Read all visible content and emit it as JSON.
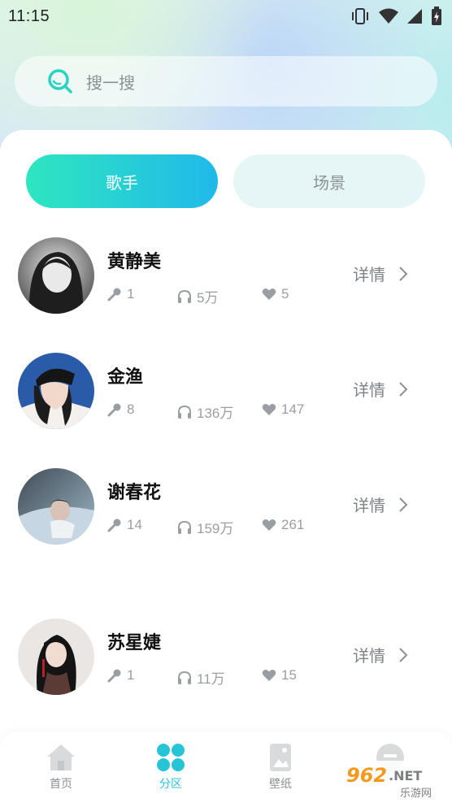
{
  "status_bar": {
    "time": "11:15"
  },
  "search": {
    "placeholder": "搜一搜"
  },
  "tabs": [
    {
      "label": "歌手",
      "active": true
    },
    {
      "label": "场景",
      "active": false
    }
  ],
  "artists": [
    {
      "name": "黄静美",
      "songs": "1",
      "plays": "5万",
      "likes": "5",
      "detail": "详情"
    },
    {
      "name": "金渔",
      "songs": "8",
      "plays": "136万",
      "likes": "147",
      "detail": "详情"
    },
    {
      "name": "谢春花",
      "songs": "14",
      "plays": "159万",
      "likes": "261",
      "detail": "详情"
    },
    {
      "name": "苏星婕",
      "songs": "1",
      "plays": "11万",
      "likes": "15",
      "detail": "详情"
    }
  ],
  "nav": [
    {
      "label": "首页",
      "icon": "home-icon"
    },
    {
      "label": "分区",
      "icon": "category-icon",
      "active": true
    },
    {
      "label": "壁纸",
      "icon": "wallpaper-icon"
    },
    {
      "label": "",
      "icon": "mine-icon"
    }
  ],
  "watermark": {
    "text": "962.NET",
    "subtext": "乐游网"
  },
  "colors": {
    "accent_start": "#2ee6bf",
    "accent_end": "#20b9ea",
    "active_nav": "#27c4d8",
    "muted_text": "#9a9ea2"
  }
}
